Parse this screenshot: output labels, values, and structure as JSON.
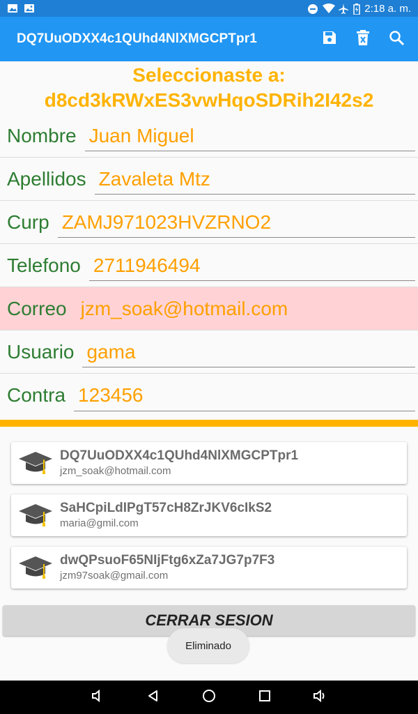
{
  "status_bar": {
    "time": "2:18 a. m.",
    "left_icons": [
      "gallery-icon",
      "image-icon"
    ],
    "right_icons": [
      "do-not-disturb-icon",
      "wifi-icon",
      "airplane-icon",
      "battery-icon"
    ]
  },
  "app_bar": {
    "title": "DQ7UuODXX4c1QUhd4NlXMGCPTpr1",
    "actions": [
      "save-icon",
      "delete-icon",
      "search-icon"
    ]
  },
  "selected": {
    "heading": "Seleccionaste a:",
    "id": "d8cd3kRWxES3vwHqoSDRih2I42s2"
  },
  "form": [
    {
      "label": "Nombre",
      "value": "Juan Miguel"
    },
    {
      "label": "Apellidos",
      "value": "Zavaleta Mtz"
    },
    {
      "label": "Curp",
      "value": "ZAMJ971023HVZRNO2"
    },
    {
      "label": "Telefono",
      "value": "2711946494"
    },
    {
      "label": "Correo",
      "value": "jzm_soak@hotmail.com"
    },
    {
      "label": "Usuario",
      "value": "gama"
    },
    {
      "label": "Contra",
      "value": "123456"
    }
  ],
  "cards": [
    {
      "title": "DQ7UuODXX4c1QUhd4NlXMGCPTpr1",
      "email": "jzm_soak@hotmail.com"
    },
    {
      "title": "SaHCpiLdIPgT57cH8ZrJKV6cIkS2",
      "email": "maria@gmil.com"
    },
    {
      "title": "dwQPsuoF65NIjFtg6xZa7JG7p7F3",
      "email": "jzm97soak@gmail.com"
    }
  ],
  "logout_label": "CERRAR SESION",
  "toast": "Eliminado",
  "nav": [
    "volume-down-icon",
    "back-icon",
    "home-icon",
    "recents-icon",
    "volume-up-icon"
  ],
  "colors": {
    "status_bar": "#1e7fd4",
    "app_bar": "#2196f3",
    "label_green": "#2e7d32",
    "value_orange": "#ffa000",
    "highlight_pink": "#ffd3d6",
    "divider_orange": "#ffb300"
  }
}
